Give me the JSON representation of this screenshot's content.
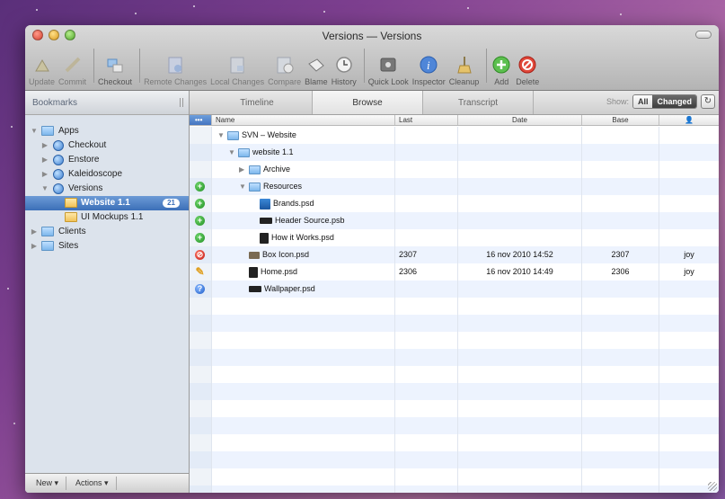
{
  "window": {
    "title": "Versions — Versions"
  },
  "toolbar": {
    "buttons": [
      {
        "label": "Update",
        "icon": "update-icon",
        "dim": true
      },
      {
        "label": "Commit",
        "icon": "commit-icon",
        "dim": true
      },
      {
        "label": "Checkout",
        "icon": "checkout-icon",
        "dim": false
      },
      {
        "label": "Remote Changes",
        "icon": "remote-changes-icon",
        "dim": true
      },
      {
        "label": "Local Changes",
        "icon": "local-changes-icon",
        "dim": true
      },
      {
        "label": "Compare",
        "icon": "compare-icon",
        "dim": true
      },
      {
        "label": "Blame",
        "icon": "blame-icon",
        "dim": false
      },
      {
        "label": "History",
        "icon": "history-icon",
        "dim": false
      },
      {
        "label": "Quick Look",
        "icon": "eye-icon",
        "dim": false
      },
      {
        "label": "Inspector",
        "icon": "info-icon",
        "dim": false
      },
      {
        "label": "Cleanup",
        "icon": "broom-icon",
        "dim": false
      },
      {
        "label": "Add",
        "icon": "add-icon",
        "dim": false
      },
      {
        "label": "Delete",
        "icon": "delete-icon",
        "dim": false
      }
    ]
  },
  "sidebar": {
    "header": "Bookmarks",
    "tree": {
      "apps": "Apps",
      "checkout": "Checkout",
      "enstore": "Enstore",
      "kaleidoscope": "Kaleidoscope",
      "versions": "Versions",
      "website": "Website 1.1",
      "website_badge": "21",
      "mockups": "UI Mockups 1.1",
      "clients": "Clients",
      "sites": "Sites"
    },
    "footer": {
      "new": "New ▾",
      "actions": "Actions ▾"
    }
  },
  "tabs": {
    "timeline": "Timeline",
    "browse": "Browse",
    "transcript": "Transcript"
  },
  "show": {
    "label": "Show:",
    "all": "All",
    "changed": "Changed",
    "refresh_icon": "↻"
  },
  "columns": {
    "status": "•••",
    "name": "Name",
    "last": "Last",
    "date": "Date",
    "base": "Base",
    "user": "👤"
  },
  "rows": [
    {
      "status": "",
      "name": "SVN – Website",
      "indent": 0,
      "tri": "▼",
      "icon": "folder",
      "last": "",
      "date": "",
      "base": "",
      "user": ""
    },
    {
      "status": "",
      "name": "website 1.1",
      "indent": 1,
      "tri": "▼",
      "icon": "folder",
      "last": "",
      "date": "",
      "base": "",
      "user": ""
    },
    {
      "status": "",
      "name": "Archive",
      "indent": 2,
      "tri": "▶",
      "icon": "folder",
      "last": "",
      "date": "",
      "base": "",
      "user": ""
    },
    {
      "status": "add",
      "name": "Resources",
      "indent": 2,
      "tri": "▼",
      "icon": "folder",
      "last": "",
      "date": "",
      "base": "",
      "user": ""
    },
    {
      "status": "add",
      "name": "Brands.psd",
      "indent": 3,
      "tri": "",
      "icon": "brand",
      "last": "",
      "date": "",
      "base": "",
      "user": ""
    },
    {
      "status": "add",
      "name": "Header Source.psb",
      "indent": 3,
      "tri": "",
      "icon": "psb",
      "last": "",
      "date": "",
      "base": "",
      "user": ""
    },
    {
      "status": "add",
      "name": "How it Works.psd",
      "indent": 3,
      "tri": "",
      "icon": "psd",
      "last": "",
      "date": "",
      "base": "",
      "user": ""
    },
    {
      "status": "del",
      "name": "Box Icon.psd",
      "indent": 2,
      "tri": "",
      "icon": "box",
      "last": "2307",
      "date": "16 nov 2010 14:52",
      "base": "2307",
      "user": "joy"
    },
    {
      "status": "mod",
      "name": "Home.psd",
      "indent": 2,
      "tri": "",
      "icon": "psd",
      "last": "2306",
      "date": "16 nov 2010 14:49",
      "base": "2306",
      "user": "joy"
    },
    {
      "status": "q",
      "name": "Wallpaper.psd",
      "indent": 2,
      "tri": "",
      "icon": "psb",
      "last": "",
      "date": "",
      "base": "",
      "user": ""
    }
  ],
  "empty_rows": 12
}
